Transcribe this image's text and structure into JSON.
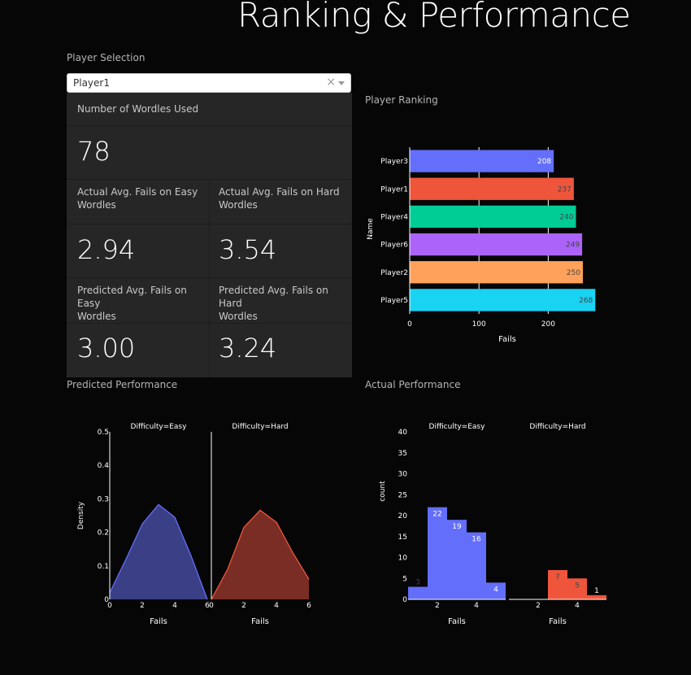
{
  "page": {
    "title": "Ranking & Performance"
  },
  "player_selection": {
    "label": "Player Selection",
    "selected": "Player1",
    "clear_glyph": "×"
  },
  "stats": {
    "wordles_used": {
      "label": "Number of Wordles Used",
      "value": "78"
    },
    "actual_easy": {
      "label_line1": "Actual Avg. Fails on Easy",
      "label_line2": "Wordles",
      "value": "2.94"
    },
    "actual_hard": {
      "label_line1": "Actual Avg. Fails on Hard",
      "label_line2": "Wordles",
      "value": "3.54"
    },
    "predicted_easy": {
      "label_line1": "Predicted Avg. Fails on Easy",
      "label_line2": "Wordles",
      "value": "3.00"
    },
    "predicted_hard": {
      "label_line1": "Predicted Avg. Fails on Hard",
      "label_line2": "Wordles",
      "value": "3.24"
    }
  },
  "sections": {
    "ranking": "Player Ranking",
    "predicted": "Predicted Performance",
    "actual": "Actual Performance"
  },
  "chart_data": [
    {
      "id": "ranking",
      "type": "bar",
      "orientation": "horizontal",
      "xlabel": "Fails",
      "ylabel": "Name",
      "xlim": [
        0,
        270
      ],
      "xticks": [
        0,
        100,
        200
      ],
      "categories": [
        "Player3",
        "Player1",
        "Player4",
        "Player6",
        "Player2",
        "Player5"
      ],
      "values": [
        208,
        237,
        240,
        249,
        250,
        268
      ],
      "colors": [
        "#636efa",
        "#ef553b",
        "#00cc96",
        "#ab63fa",
        "#ffa15a",
        "#19d3f3"
      ],
      "label_colors": [
        "#ffffff",
        "#444444",
        "#444444",
        "#444444",
        "#444444",
        "#444444"
      ]
    },
    {
      "id": "predicted",
      "type": "area",
      "ylabel": "Density",
      "ylim": [
        0,
        0.5
      ],
      "yticks": [
        0,
        0.1,
        0.2,
        0.3,
        0.4,
        0.5
      ],
      "panels": [
        {
          "title": "Difficulty=Easy",
          "xlabel": "Fails",
          "xlim": [
            0,
            6
          ],
          "xticks": [
            0,
            2,
            4,
            6
          ],
          "color": "#636efa",
          "fill": "#3b3f86",
          "points": [
            [
              0,
              0.02
            ],
            [
              1,
              0.12
            ],
            [
              2,
              0.225
            ],
            [
              3,
              0.283
            ],
            [
              4,
              0.245
            ],
            [
              5,
              0.13
            ],
            [
              6,
              0.0
            ]
          ]
        },
        {
          "title": "Difficulty=Hard",
          "xlabel": "Fails",
          "xlim": [
            0,
            6
          ],
          "xticks": [
            0,
            2,
            4,
            6
          ],
          "color": "#ef553b",
          "fill": "#7a2d24",
          "points": [
            [
              0,
              0.0
            ],
            [
              1,
              0.09
            ],
            [
              2,
              0.215
            ],
            [
              3,
              0.266
            ],
            [
              4,
              0.23
            ],
            [
              5,
              0.14
            ],
            [
              6,
              0.06
            ]
          ]
        }
      ]
    },
    {
      "id": "actual",
      "type": "bar",
      "ylabel": "count",
      "ylim": [
        0,
        40
      ],
      "yticks": [
        0,
        5,
        10,
        15,
        20,
        25,
        30,
        35,
        40
      ],
      "panels": [
        {
          "title": "Difficulty=Easy",
          "xlabel": "Fails",
          "xlim": [
            0.5,
            5.5
          ],
          "xticks": [
            2,
            4
          ],
          "color": "#636efa",
          "bars": [
            {
              "x0": 0.5,
              "x1": 1.5,
              "count": 3
            },
            {
              "x0": 1.5,
              "x1": 2.5,
              "count": 22
            },
            {
              "x0": 2.5,
              "x1": 3.5,
              "count": 19
            },
            {
              "x0": 3.5,
              "x1": 4.5,
              "count": 16
            },
            {
              "x0": 4.5,
              "x1": 5.5,
              "count": 4
            }
          ]
        },
        {
          "title": "Difficulty=Hard",
          "xlabel": "Fails",
          "xlim": [
            0.5,
            5.5
          ],
          "xticks": [
            2,
            4
          ],
          "color": "#ef553b",
          "bars": [
            {
              "x0": 2.5,
              "x1": 3.5,
              "count": 7
            },
            {
              "x0": 3.5,
              "x1": 4.5,
              "count": 5
            },
            {
              "x0": 4.5,
              "x1": 5.5,
              "count": 1
            }
          ]
        }
      ]
    }
  ]
}
